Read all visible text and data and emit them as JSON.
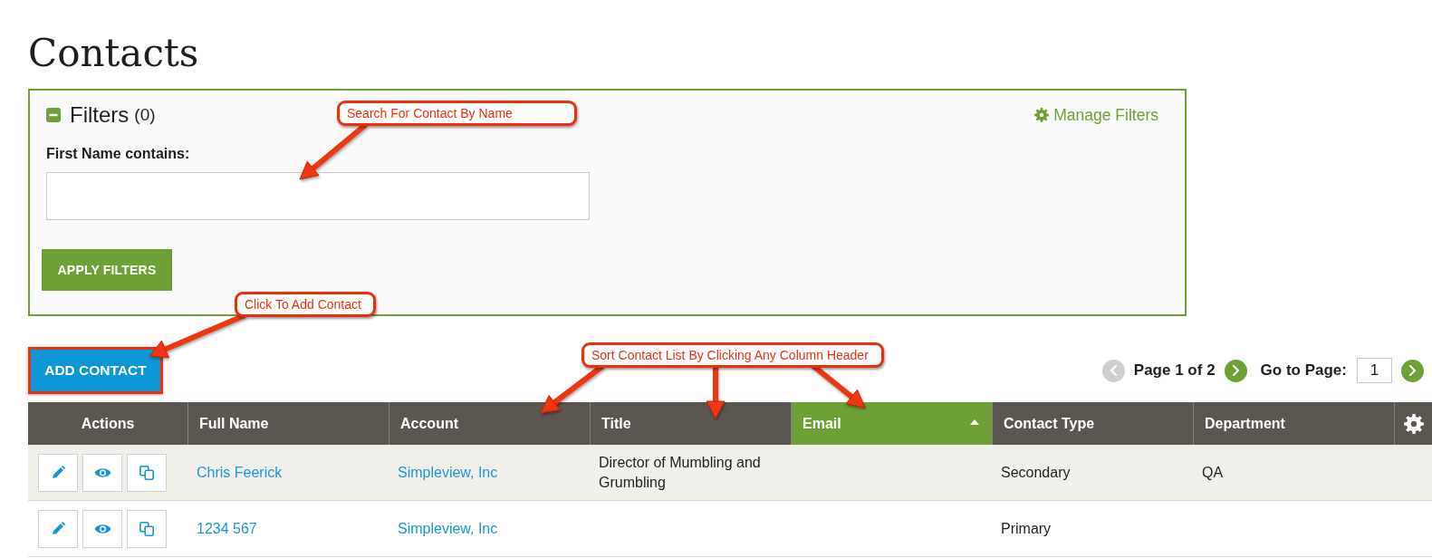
{
  "page": {
    "title": "Contacts"
  },
  "filters": {
    "title": "Filters",
    "count": "(0)",
    "expanded": true,
    "manage_label": "Manage Filters",
    "fields": [
      {
        "label": "First Name contains:"
      }
    ],
    "apply_button": "APPLY FILTERS"
  },
  "add_contact_button": {
    "label": "ADD CONTACT",
    "highlighted": true
  },
  "pagination": {
    "prev_disabled": true,
    "page_label": "Page 1 of 2",
    "next_disabled": false,
    "go_to_label": "Go to Page:",
    "go_to_value": "1"
  },
  "table": {
    "columns": [
      {
        "label": "Actions",
        "kind": "actions",
        "sorted": false
      },
      {
        "label": "Full Name",
        "kind": "link",
        "sorted": false
      },
      {
        "label": "Account",
        "kind": "link",
        "sorted": false
      },
      {
        "label": "Title",
        "kind": "text",
        "sorted": false
      },
      {
        "label": "Email",
        "kind": "text",
        "sorted": true,
        "ascending": true
      },
      {
        "label": "Contact Type",
        "kind": "text",
        "sorted": false
      },
      {
        "label": "Department",
        "kind": "text",
        "sorted": false
      }
    ],
    "rows": [
      {
        "full_name": "Chris Feerick",
        "account": "Simpleview, Inc",
        "title": "Director of Mumbling and Grumbling",
        "contact_type": "Secondary",
        "department": "QA"
      },
      {
        "full_name": "1234 567",
        "account": "Simpleview, Inc",
        "contact_type": "Primary"
      }
    ]
  },
  "annotations": [
    {
      "text": "Search For Contact By Name"
    },
    {
      "text": "Click To Add Contact"
    },
    {
      "text": "Sort Contact List By Clicking Any Column Header"
    }
  ]
}
